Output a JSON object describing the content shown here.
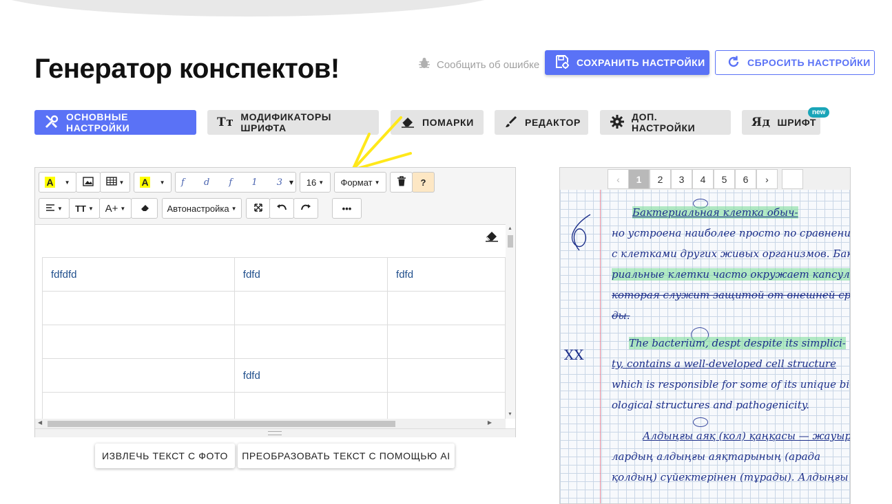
{
  "header": {
    "title": "Генератор конспектов!",
    "report_link": "Сообщить об ошибке",
    "save_button": "СОХРАНИТЬ НАСТРОЙКИ",
    "reset_button": "СБРОСИТЬ НАСТРОЙКИ"
  },
  "tabs": [
    {
      "label": "ОСНОВНЫЕ НАСТРОЙКИ",
      "icon": "tools-icon",
      "active": true
    },
    {
      "label": "МОДИФИКАТОРЫ ШРИФТА",
      "icon": "text-size-icon"
    },
    {
      "label": "ПОМАРКИ",
      "icon": "eraser-icon"
    },
    {
      "label": "РЕДАКТОР",
      "icon": "pen-icon"
    },
    {
      "label": "ДОП. НАСТРОЙКИ",
      "icon": "gear-icon"
    },
    {
      "label": "ШРИФТ",
      "icon": "font-glyph-icon",
      "badge": "new"
    }
  ],
  "toolbar": {
    "font_preview": "f d f 1 3",
    "font_size": "16",
    "format_label": "Формат",
    "help_label": "?",
    "autosettings_label": "Автонастройка",
    "more_label": "•••",
    "text_size_label": "TT",
    "font_grow_label": "A+"
  },
  "table": {
    "rows": [
      [
        "fdfdfd",
        "fdfd",
        "fdfd"
      ],
      [
        "",
        "",
        ""
      ],
      [
        "",
        "",
        ""
      ],
      [
        "",
        "fdfd",
        ""
      ],
      [
        "",
        "",
        ""
      ]
    ]
  },
  "actions": {
    "extract": "ИЗВЛЕЧЬ ТЕКСТ С ФОТО",
    "transform": "ПРЕОБРАЗОВАТЬ ТЕКСТ С ПОМОЩЬЮ AI"
  },
  "preview": {
    "pages": [
      "‹",
      "1",
      "2",
      "3",
      "4",
      "5",
      "6",
      "›"
    ],
    "current_page": "1",
    "lines": [
      "Бактериальная клетка обыч-",
      "но устроена наиболее просто по сравнению",
      "с клетками других живых организмов. Бакте-",
      "риальные клетки часто окружает капсула,",
      "которая служит защитой от внешней сре-",
      "ды.",
      "The bacterium, despt despite its simplici-",
      "ty, contains a well-developed cell structure",
      "which is responsible for some of its unique bi-",
      "ological structures and pathogenicity.",
      "Алдыңғы аяқ (кол) қаңқасы — жауыр-",
      "лардың алдыңғы аяқтарының (арада",
      "қолдың) сүйектерінен (тұрады). Алдыңғы аяқ"
    ],
    "margin_note": "XX"
  },
  "colors": {
    "accent": "#5a72f6",
    "badge": "#1aa5b8",
    "highlight_yellow": "#ffff00",
    "ink": "#1c2f8a"
  }
}
